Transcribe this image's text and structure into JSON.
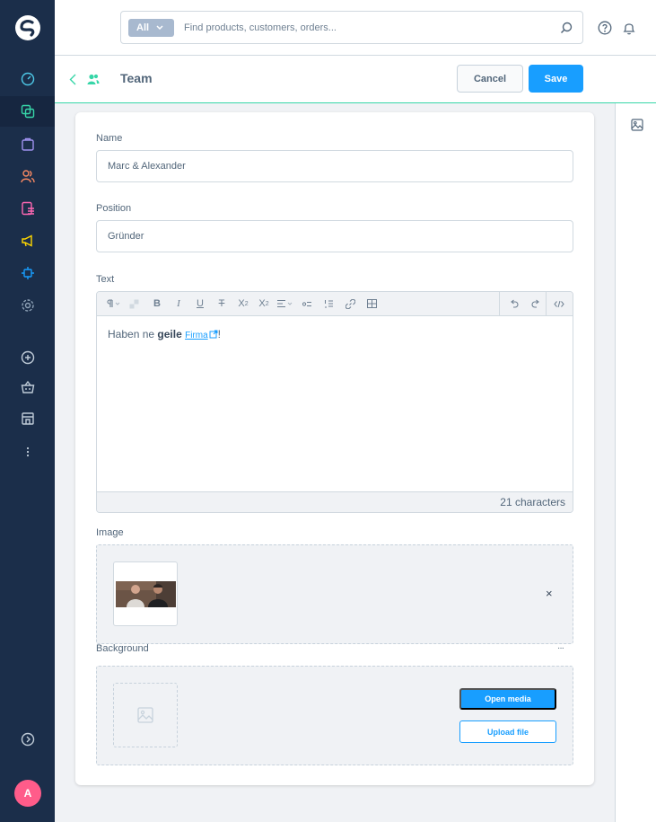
{
  "sidebar": {
    "avatar_initial": "A",
    "icons": [
      "dashboard-icon",
      "catalogue-icon",
      "orders-icon",
      "customers-icon",
      "content-icon",
      "marketing-icon",
      "extensions-icon",
      "settings-icon",
      "add-icon",
      "basket-icon",
      "storefront-icon",
      "more-icon",
      "expand-icon"
    ]
  },
  "search": {
    "type_label": "All",
    "placeholder": "Find products, customers, orders..."
  },
  "header": {
    "title": "Team",
    "cancel_label": "Cancel",
    "save_label": "Save"
  },
  "form": {
    "name_label": "Name",
    "name_value": "Marc & Alexander",
    "position_label": "Position",
    "position_value": "Gründer",
    "text_label": "Text",
    "text_content": {
      "prefix": "Haben ne ",
      "bold": "geile",
      "link": "Firma",
      "suffix": "!"
    },
    "char_count": "21 characters",
    "image_label": "Image",
    "background_label": "Background",
    "open_media_label": "Open media",
    "upload_file_label": "Upload file",
    "remove_symbol": "×",
    "more_symbol": "···"
  },
  "colors": {
    "sidebar_bg": "#1b2e4a",
    "accent": "#189eff",
    "header_border": "#37d6a8",
    "avatar": "#ff5c8a"
  }
}
